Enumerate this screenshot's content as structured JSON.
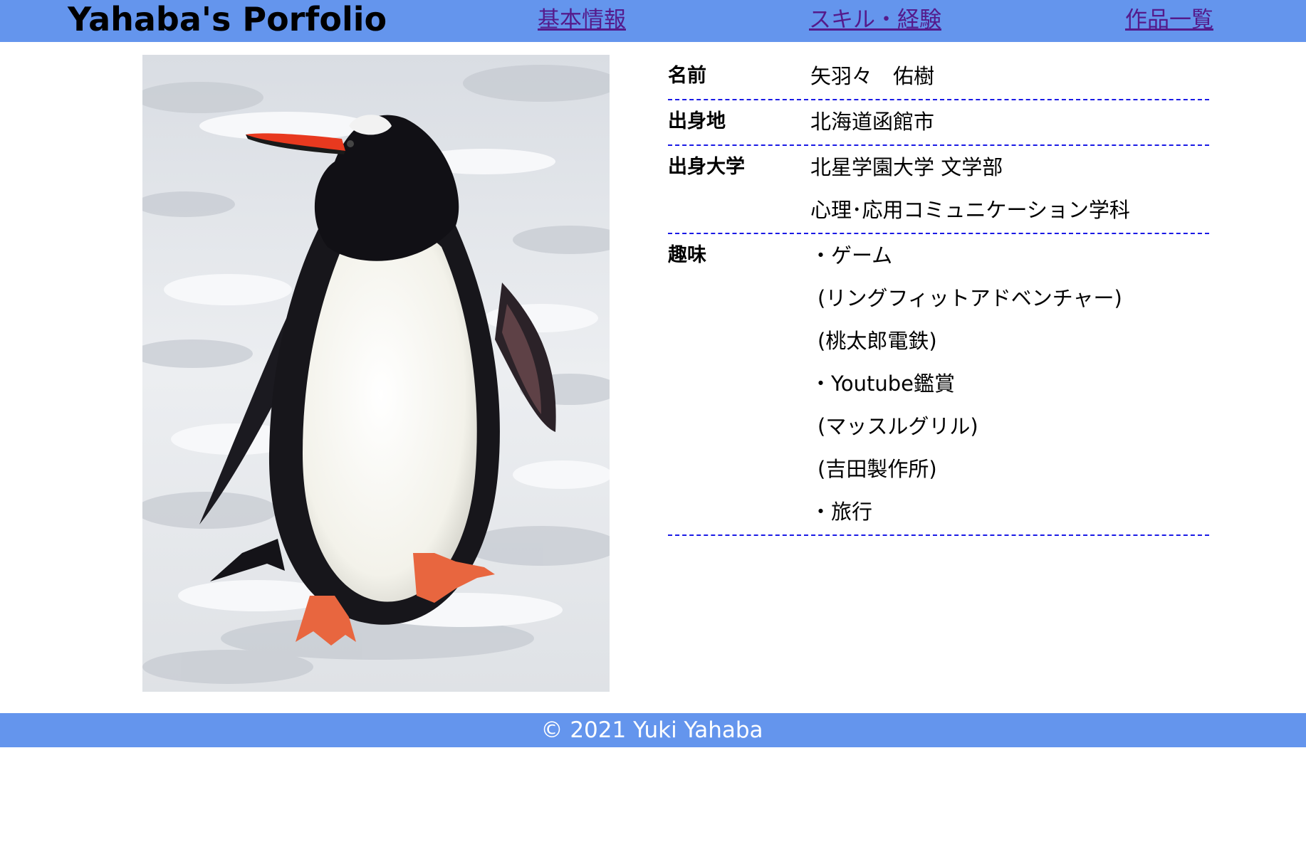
{
  "header": {
    "title": "Yahaba's Porfolio",
    "background_color": "#6495ed",
    "nav": [
      {
        "label": "基本情報"
      },
      {
        "label": "スキル・経験"
      },
      {
        "label": "作品一覧"
      }
    ],
    "link_color": "#551a8b"
  },
  "photo": {
    "subject": "penguin"
  },
  "profile": {
    "rows": [
      {
        "label": "名前",
        "values": [
          "矢羽々　佑樹"
        ]
      },
      {
        "label": "出身地",
        "values": [
          "北海道函館市"
        ]
      },
      {
        "label": "出身大学",
        "values": [
          "北星学園大学 文学部",
          "心理･応用コミュニケーション学科"
        ]
      },
      {
        "label": "趣味",
        "values": [
          "・ゲーム",
          "(リングフィットアドベンチャー)",
          "(桃太郎電鉄)",
          "・Youtube鑑賞",
          "(マッスルグリル)",
          "(吉田製作所)",
          "・旅行"
        ]
      }
    ],
    "divider_color": "#1a1ae6"
  },
  "footer": {
    "text": "© 2021 Yuki Yahaba"
  }
}
